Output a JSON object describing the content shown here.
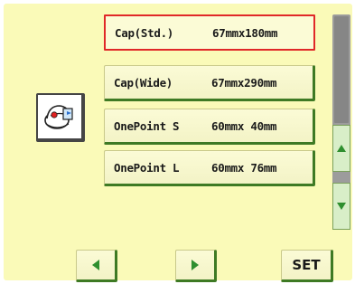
{
  "frames": [
    {
      "name": "Cap(Std.)",
      "size": "67mmx180mm",
      "selected": true
    },
    {
      "name": "Cap(Wide)",
      "size": "67mmx290mm",
      "selected": false
    },
    {
      "name": "OnePoint S",
      "size": "60mmx 40mm",
      "selected": false
    },
    {
      "name": "OnePoint L",
      "size": "60mmx 76mm",
      "selected": false
    }
  ],
  "set_label": "SET",
  "icons": {
    "frame_type": "cap-frame-icon",
    "scroll_up": "triangle-up-icon",
    "scroll_down": "triangle-down-icon",
    "prev": "triangle-left-icon",
    "next": "triangle-right-icon"
  },
  "colors": {
    "panel": "#fafab8",
    "selected_border": "#e02828",
    "arrow_green": "#2f8f2f",
    "scrollbar": "#9c9c9c"
  }
}
